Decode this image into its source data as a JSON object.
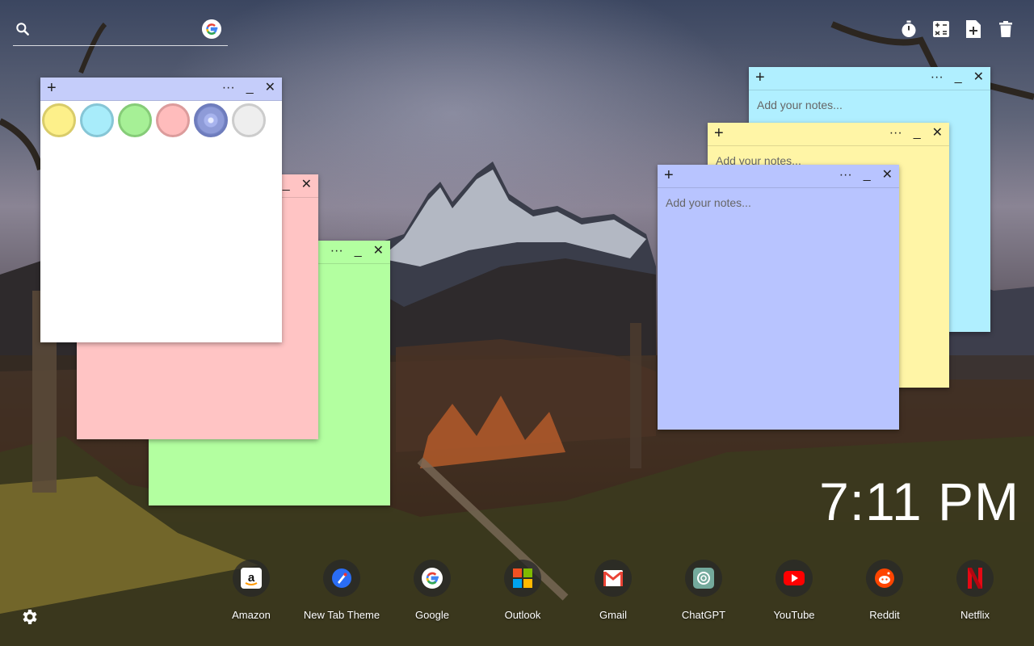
{
  "search": {
    "value": "",
    "placeholder": ""
  },
  "notes": {
    "placeholder": "Add your notes...",
    "white": {
      "color": "#ffffff",
      "header": "#c5cdfa"
    },
    "pink": {
      "color": "#ffc4c4"
    },
    "green": {
      "color": "#b3ffa0"
    },
    "cyan": {
      "color": "#b0efff"
    },
    "yellow": {
      "color": "#fff5a6"
    },
    "blue": {
      "color": "#b8c4ff"
    },
    "palette": [
      "#fdf08a",
      "#a8ecfa",
      "#a6f096",
      "#ffbcbc",
      "#8e9bd8",
      "#eeeeee"
    ]
  },
  "controls": {
    "plus": "+",
    "more": "···",
    "minimize": "_",
    "close": "✕"
  },
  "clock": {
    "time": "7:11 PM"
  },
  "dock": [
    {
      "label": "Amazon",
      "icon": "amazon-icon"
    },
    {
      "label": "New Tab Theme",
      "icon": "new-tab-theme-icon"
    },
    {
      "label": "Google",
      "icon": "google-icon"
    },
    {
      "label": "Outlook",
      "icon": "outlook-icon"
    },
    {
      "label": "Gmail",
      "icon": "gmail-icon"
    },
    {
      "label": "ChatGPT",
      "icon": "chatgpt-icon"
    },
    {
      "label": "YouTube",
      "icon": "youtube-icon"
    },
    {
      "label": "Reddit",
      "icon": "reddit-icon"
    },
    {
      "label": "Netflix",
      "icon": "netflix-icon"
    }
  ]
}
